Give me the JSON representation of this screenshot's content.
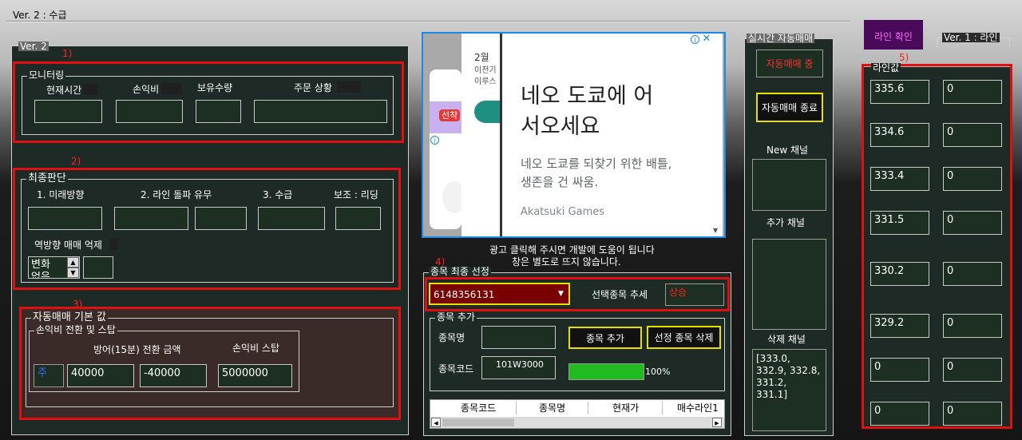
{
  "window": {
    "title": "Ver. 2 : 수급"
  },
  "ver2_group": {
    "label": "Ver. 2"
  },
  "section_markers": {
    "s1": "1)",
    "s2": "2)",
    "s3": "3)",
    "s4": "4)",
    "s5": "5)"
  },
  "monitoring": {
    "label": "모니터링",
    "headers": {
      "time": "현재시간",
      "pnl": "손익비",
      "holding": "보유수량",
      "order": "주문 상황"
    }
  },
  "final_judgment": {
    "label": "최종판단",
    "headers": {
      "future": "1. 미래방향",
      "line_breach": "2. 라인 돌파 유무",
      "supply": "3. 수급",
      "aux": "보조 : 리딩"
    },
    "reverse_label": "역방향 매매 억제",
    "change_lines": [
      "변화",
      "없음"
    ]
  },
  "auto_defaults": {
    "label": "자동매매 기본 값",
    "sub_label": "손익비 전환 및 스탑",
    "defense_label": "방어(15분) 전환 금액",
    "stop_label": "손익비 스탑",
    "toggle": "주",
    "value1": "40000",
    "value2": "-40000",
    "value3": "5000000"
  },
  "ad": {
    "headline": "네오 도쿄에 어서오세요",
    "body": "네오 도쿄를 되찾기 위한 배틀, 생존을 건 싸움.",
    "publisher": "Akatsuki Games",
    "left_preview": {
      "date": "2월",
      "line1": "이전기",
      "line2": "이루스",
      "tag": "선착"
    },
    "note1": "광고 클릭해 주시면 개발에 도움이 됩니다",
    "note2": "창은 별도로 뜨지 않습니다."
  },
  "stock_select": {
    "label": "종목 최종 선정",
    "dropdown_value": "6148356131",
    "trend_label": "선택종목 추세",
    "trend_value": "상승",
    "trend_color": "#ff2020"
  },
  "stock_add": {
    "label": "종목 추가",
    "name_label": "종목명",
    "code_label": "종목코드",
    "code_value": "101W3000",
    "add_button": "종목 추가",
    "delete_button": "선정 종목 삭제",
    "progress_percent": 100,
    "progress_text": "100%",
    "progress_color": "#22bb22",
    "table_headers": [
      "종목코드",
      "종목명",
      "현재가",
      "매수라인1"
    ]
  },
  "realtime": {
    "label": "실시간 자동매매",
    "status": "자동매매 중",
    "status_color": "#ff3030",
    "stop_button": "자동매매 종료",
    "new_channel": "New 채널",
    "add_channel": "추가 채널",
    "delete_channel": "삭제 채널",
    "delete_values": "[333.0,\n332.9, 332.8,\n331.2,\n331.1]"
  },
  "top_right": {
    "confirm_button": "라인 확인",
    "confirm_color": "#ff66ff",
    "ver1_label": "Ver. 1 : 라인"
  },
  "line_values": {
    "label": "라인값",
    "rows": [
      {
        "value": "335.6",
        "count": "0"
      },
      {
        "value": "334.6",
        "count": "0"
      },
      {
        "value": "333.4",
        "count": "0"
      },
      {
        "value": "331.5",
        "count": "0"
      },
      {
        "value": "330.2",
        "count": "0"
      },
      {
        "value": "329.2",
        "count": "0"
      },
      {
        "value": "0",
        "count": "0"
      },
      {
        "value": "0",
        "count": "0"
      }
    ]
  }
}
